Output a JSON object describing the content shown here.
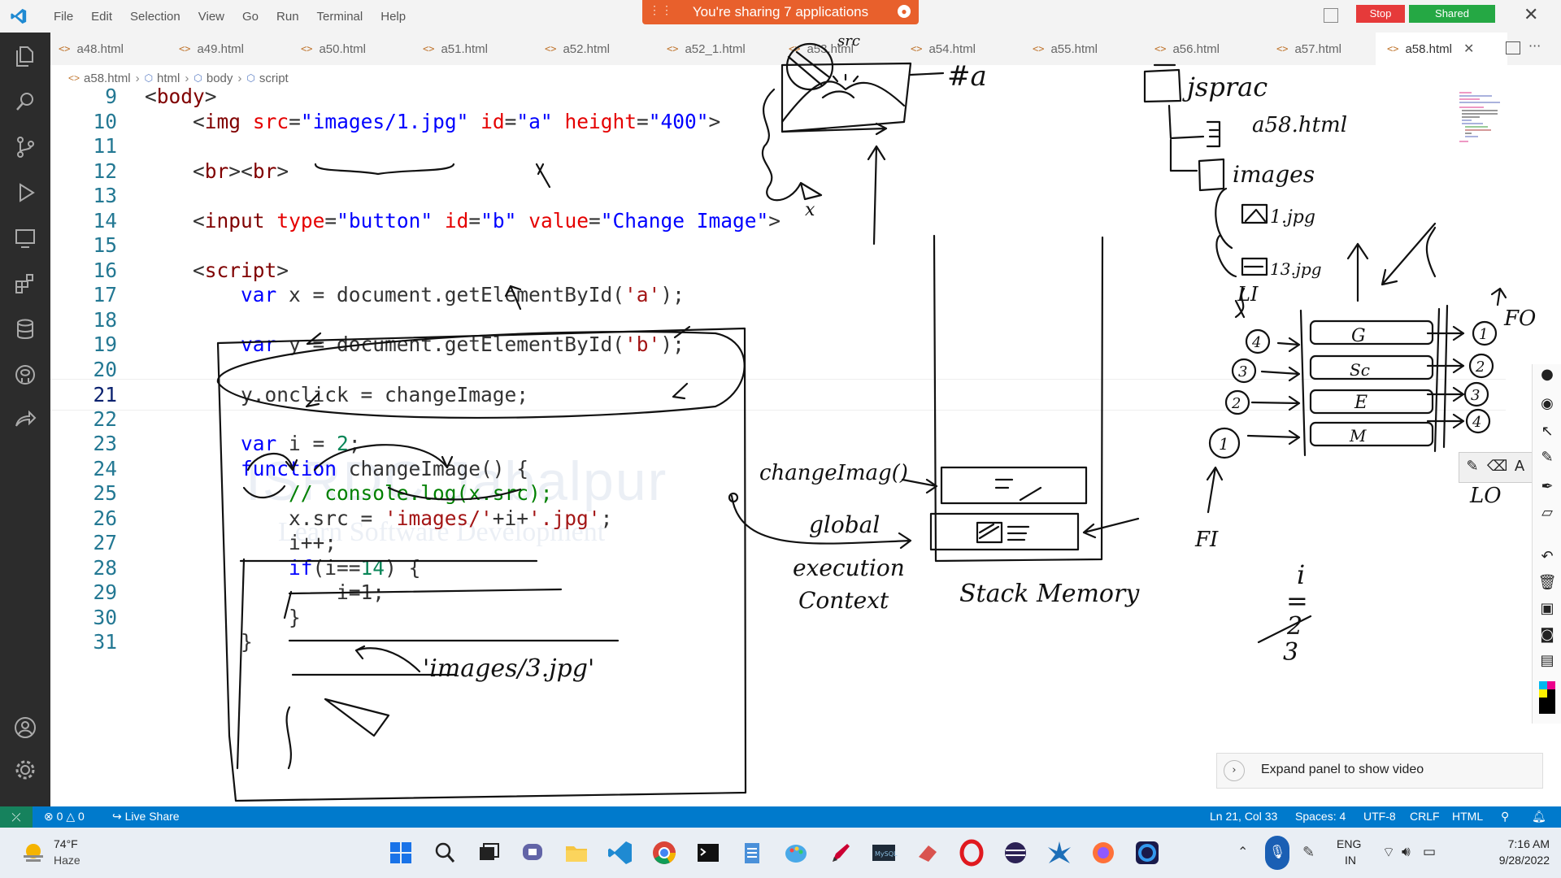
{
  "menu": [
    "File",
    "Edit",
    "Selection",
    "View",
    "Go",
    "Run",
    "Terminal",
    "Help"
  ],
  "share_banner": "You're sharing 7 applications",
  "title_buttons": {
    "stop": "Stop",
    "shared": "Shared"
  },
  "tabs": [
    "a48.html",
    "a49.html",
    "a50.html",
    "a51.html",
    "a52.html",
    "a52_1.html",
    "a53.html",
    "a54.html",
    "a55.html",
    "a56.html",
    "a57.html",
    "a58.html"
  ],
  "active_tab": "a58.html",
  "breadcrumb": [
    "a58.html",
    "html",
    "body",
    "script"
  ],
  "editor": {
    "current_line": 21,
    "lines": [
      {
        "n": "9",
        "code": "<body>"
      },
      {
        "n": "10",
        "code": "    <img src=\"images/1.jpg\" id=\"a\" height=\"400\">"
      },
      {
        "n": "11",
        "code": ""
      },
      {
        "n": "12",
        "code": "    <br><br>"
      },
      {
        "n": "13",
        "code": ""
      },
      {
        "n": "14",
        "code": "    <input type=\"button\" id=\"b\" value=\"Change Image\">"
      },
      {
        "n": "15",
        "code": ""
      },
      {
        "n": "16",
        "code": "    <script>"
      },
      {
        "n": "17",
        "code": "        var x = document.getElementById('a');"
      },
      {
        "n": "18",
        "code": ""
      },
      {
        "n": "19",
        "code": "        var y = document.getElementById('b');"
      },
      {
        "n": "20",
        "code": ""
      },
      {
        "n": "21",
        "code": "        y.onclick = changeImage;"
      },
      {
        "n": "22",
        "code": ""
      },
      {
        "n": "23",
        "code": "        var i = 2;"
      },
      {
        "n": "24",
        "code": "        function changeImage() {"
      },
      {
        "n": "25",
        "code": "            // console.log(x.src);"
      },
      {
        "n": "26",
        "code": "            x.src = 'images/'+i+'.jpg';"
      },
      {
        "n": "27",
        "code": "            i++;"
      },
      {
        "n": "28",
        "code": "            if(i==14) {"
      },
      {
        "n": "29",
        "code": "                i=1;"
      },
      {
        "n": "30",
        "code": "            }"
      },
      {
        "n": "31",
        "code": "        }"
      }
    ]
  },
  "watermark": {
    "line1": "ISRDC Jabalpur",
    "line2": "Learn Software Development"
  },
  "annotations": {
    "src_label": "src",
    "id_a_label": "#a",
    "x_label": "x",
    "changeimage_label": "changeImag()",
    "global_ec": [
      "global",
      "execution",
      "Context"
    ],
    "stack_memory": "Stack Memory",
    "tree": {
      "root": "jsprac",
      "file": "a58.html",
      "folder": "images",
      "first": "1.jpg",
      "last": "13.jpg"
    },
    "queue_items": [
      "G",
      "Sc",
      "E",
      "M"
    ],
    "queue_in": [
      "4",
      "3",
      "2",
      "1"
    ],
    "queue_out": [
      "1",
      "2",
      "3",
      "4"
    ],
    "labels": {
      "fi": "FI",
      "fo": "FO",
      "li": "LI",
      "lo": "LO"
    },
    "images_3": "'images/3.jpg'",
    "counter": [
      "i",
      "=",
      "2",
      "3"
    ]
  },
  "video_panel": "Expand panel to show video",
  "statusbar": {
    "errors": "0",
    "warnings": "0",
    "liveshare": "Live Share",
    "position": "Ln 21, Col 33",
    "spaces": "Spaces: 4",
    "encoding": "UTF-8",
    "eol": "CRLF",
    "language": "HTML"
  },
  "taskbar": {
    "temperature": "74°F",
    "condition": "Haze",
    "lang1": "ENG",
    "lang2": "IN",
    "time": "7:16 AM",
    "date": "9/28/2022"
  },
  "colors": {
    "accent": "#007acc",
    "share_banner": "#e8602c",
    "stop": "#e63a3a",
    "shared": "#25a844"
  }
}
